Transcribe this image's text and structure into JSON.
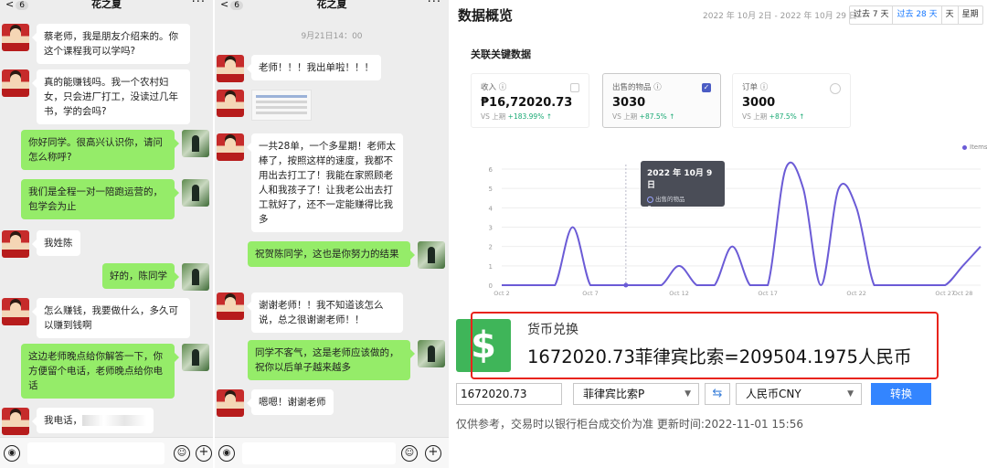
{
  "chat_left": {
    "back_label": "<",
    "unread_count": "6",
    "title": "花之夏",
    "more": "···",
    "messages": [
      {
        "side": "left",
        "text": "蔡老师，我是朋友介绍来的。你这个课程我可以学吗?"
      },
      {
        "side": "left",
        "text": "真的能赚钱吗。我一个农村妇女，只会进厂打工，没读过几年书，学的会吗?"
      },
      {
        "side": "right",
        "text": "你好同学。很高兴认识你，请问怎么称呼?"
      },
      {
        "side": "right",
        "text": "我们是全程一对一陪跑运营的，包学会为止"
      },
      {
        "side": "left",
        "text": "我姓陈"
      },
      {
        "side": "right",
        "text": "好的，陈同学"
      },
      {
        "side": "left",
        "text": "怎么赚钱，我要做什么，多久可以赚到钱啊"
      },
      {
        "side": "right",
        "text": "这边老师晚点给你解答一下，你方便留个电话，老师晚点给你电话"
      },
      {
        "side": "left",
        "text": "我电话，"
      }
    ]
  },
  "chat_right": {
    "back_label": "<",
    "unread_count": "6",
    "title": "花之夏",
    "more": "···",
    "timestamp": "9月21日14：00",
    "messages": [
      {
        "side": "left",
        "text": "老师！！！我出单啦！！！"
      },
      {
        "side": "left",
        "text": "一共28单，一个多星期！老师太棒了，按照这样的速度，我都不用出去打工了！我能在家照顾老人和我孩子了！让我老公出去打工就好了，还不一定能赚得比我多"
      },
      {
        "side": "right",
        "text": "祝贺陈同学，这也是你努力的结果"
      },
      {
        "side": "left",
        "text": "谢谢老师！！我不知道该怎么说，总之很谢谢老师！！"
      },
      {
        "side": "right",
        "text": "同学不客气，这是老师应该做的，祝你以后单子越来越多"
      },
      {
        "side": "left",
        "text": "嗯嗯！谢谢老师"
      }
    ]
  },
  "dashboard": {
    "title": "数据概览",
    "date_range": "2022 年 10月 2日 - 2022 年 10月 29 日",
    "range_tabs": [
      {
        "label": "过去 7 天",
        "active": false
      },
      {
        "label": "过去 28 天",
        "active": true
      },
      {
        "label": "天",
        "active": false
      },
      {
        "label": "星期",
        "active": false
      }
    ],
    "section_title": "关联关键数据",
    "metrics": [
      {
        "label": "收入 ⓘ",
        "value": "₱16,72020.73",
        "vs_prefix": "VS 上期",
        "vs_change": "+183.99% ↑",
        "checked": false
      },
      {
        "label": "出售的物品 ⓘ",
        "value": "3030",
        "vs_prefix": "VS 上期",
        "vs_change": "+87.5% ↑",
        "checked": true
      },
      {
        "label": "订单 ⓘ",
        "value": "3000",
        "vs_prefix": "VS 上期",
        "vs_change": "+87.5% ↑",
        "checked": false
      }
    ],
    "tooltip": {
      "date": "2022 年 10月 9 日",
      "series": "出售的物品",
      "value": "0"
    },
    "legend": "Items"
  },
  "chart_data": {
    "type": "line",
    "legend": [
      "Items"
    ],
    "y_ticks": [
      "0",
      "1",
      "2",
      "3",
      "4",
      "5",
      "6"
    ],
    "x_ticks": [
      "Oct 2",
      "Oct 7",
      "Oct 12",
      "Oct 17",
      "Oct 22",
      "Oct 27",
      "Oct 28"
    ],
    "ylim": [
      0,
      6
    ],
    "x": [
      "Oct 2",
      "Oct 3",
      "Oct 4",
      "Oct 5",
      "Oct 6",
      "Oct 7",
      "Oct 8",
      "Oct 9",
      "Oct 10",
      "Oct 11",
      "Oct 12",
      "Oct 13",
      "Oct 14",
      "Oct 15",
      "Oct 16",
      "Oct 17",
      "Oct 18",
      "Oct 19",
      "Oct 20",
      "Oct 21",
      "Oct 22",
      "Oct 23",
      "Oct 24",
      "Oct 25",
      "Oct 26",
      "Oct 27",
      "Oct 28",
      "Oct 29"
    ],
    "series": [
      {
        "name": "Items",
        "values": [
          0,
          0,
          0,
          0,
          3,
          0,
          0,
          0,
          0,
          0,
          1,
          0,
          0,
          2,
          0,
          0,
          6,
          5,
          0,
          5,
          4,
          0,
          0,
          0,
          0,
          0,
          1,
          2
        ]
      }
    ],
    "color": "#6b5bd6"
  },
  "currency": {
    "icon": "$",
    "title": "货币兑换",
    "result": "1672020.73菲律宾比索=209504.1975人民币",
    "amount": "1672020.73",
    "from_currency": "菲律宾比索P",
    "to_currency": "人民币CNY",
    "swap_icon": "⇆",
    "convert_label": "转换",
    "note": "仅供参考，交易时以银行柜台成交价为准 更新时间:2022-11-01 15:56"
  }
}
